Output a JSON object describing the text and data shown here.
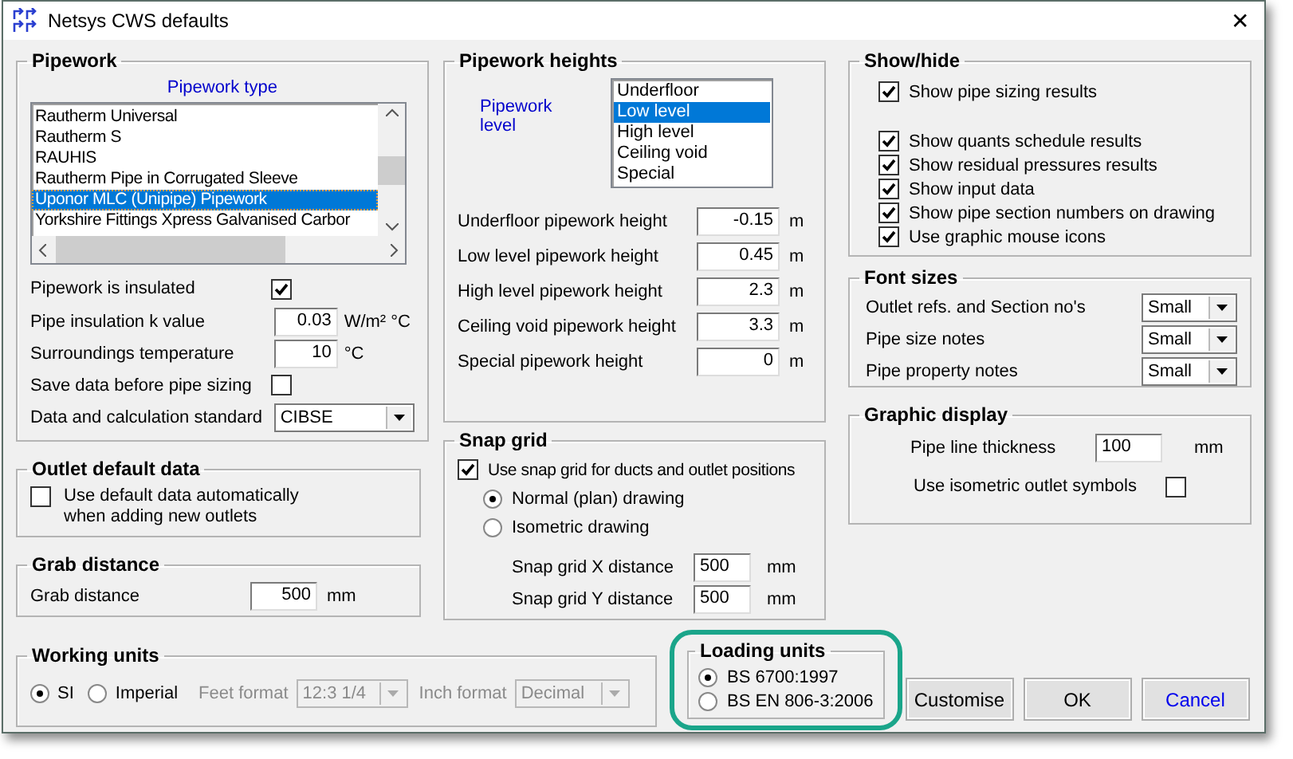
{
  "window": {
    "title": "Netsys CWS defaults",
    "close": "✕"
  },
  "pipework": {
    "title": "Pipework",
    "type_label": "Pipework type",
    "types": [
      {
        "label": "Rautherm Universal",
        "selected": false
      },
      {
        "label": "Rautherm S",
        "selected": false
      },
      {
        "label": "RAUHIS",
        "selected": false
      },
      {
        "label": "Rautherm Pipe in Corrugated Sleeve",
        "selected": false
      },
      {
        "label": "Uponor MLC (Unipipe) Pipework",
        "selected": true
      },
      {
        "label": "Yorkshire Fittings Xpress Galvanised Carbor",
        "selected": false
      }
    ],
    "fields": [
      {
        "kind": "checkbox",
        "label": "Pipework is insulated",
        "checked": true
      },
      {
        "kind": "number",
        "label": "Pipe insulation k value",
        "value": "0.03",
        "unit": "W/m² °C"
      },
      {
        "kind": "number",
        "label": "Surroundings temperature",
        "value": "10",
        "unit": "°C"
      },
      {
        "kind": "checkbox",
        "label": "Save data before pipe sizing",
        "checked": false
      },
      {
        "kind": "select",
        "label": "Data and calculation standard",
        "value": "CIBSE"
      }
    ]
  },
  "outlet_default_data": {
    "title": "Outlet default data",
    "option": {
      "label": "Use default data automatically when adding new outlets",
      "checked": false
    }
  },
  "grab_distance": {
    "title": "Grab distance",
    "label": "Grab distance",
    "value": "500",
    "unit": "mm"
  },
  "working_units": {
    "title": "Working units",
    "options": [
      {
        "label": "SI",
        "selected": true
      },
      {
        "label": "Imperial",
        "selected": false
      }
    ],
    "formats": [
      {
        "label": "Feet format",
        "value": "12:3 1/4",
        "disabled": true
      },
      {
        "label": "Inch format",
        "value": "Decimal",
        "disabled": true
      }
    ]
  },
  "pipework_heights": {
    "title": "Pipework heights",
    "level_label": "Pipework level",
    "levels": [
      {
        "label": "Underfloor",
        "selected": false
      },
      {
        "label": "Low level",
        "selected": true
      },
      {
        "label": "High level",
        "selected": false
      },
      {
        "label": "Ceiling void",
        "selected": false
      },
      {
        "label": "Special",
        "selected": false
      }
    ],
    "heights": [
      {
        "label": "Underfloor pipework height",
        "value": "-0.15",
        "unit": "m"
      },
      {
        "label": "Low level pipework height",
        "value": "0.45",
        "unit": "m"
      },
      {
        "label": "High level pipework height",
        "value": "2.3",
        "unit": "m"
      },
      {
        "label": "Ceiling void pipework height",
        "value": "3.3",
        "unit": "m"
      },
      {
        "label": "Special pipework height",
        "value": "0",
        "unit": "m"
      }
    ]
  },
  "snap_grid": {
    "title": "Snap grid",
    "use_snap": {
      "label": "Use snap grid for ducts and outlet positions",
      "checked": true
    },
    "modes": [
      {
        "label": "Normal (plan) drawing",
        "selected": true
      },
      {
        "label": "Isometric drawing",
        "selected": false
      }
    ],
    "distances": [
      {
        "label": "Snap grid X distance",
        "value": "500",
        "unit": "mm"
      },
      {
        "label": "Snap grid Y distance",
        "value": "500",
        "unit": "mm"
      }
    ]
  },
  "show_hide": {
    "title": "Show/hide",
    "groups": [
      [
        {
          "label": "Show pipe sizing results",
          "checked": true
        }
      ],
      [
        {
          "label": "Show quants schedule results",
          "checked": true
        },
        {
          "label": "Show residual pressures results",
          "checked": true
        },
        {
          "label": "Show input data",
          "checked": true
        },
        {
          "label": "Show pipe section numbers on drawing",
          "checked": true
        },
        {
          "label": "Use graphic mouse icons",
          "checked": true
        }
      ]
    ]
  },
  "font_sizes": {
    "title": "Font sizes",
    "rows": [
      {
        "label": "Outlet refs. and Section no's",
        "value": "Small"
      },
      {
        "label": "Pipe size notes",
        "value": "Small"
      },
      {
        "label": "Pipe property notes",
        "value": "Small"
      }
    ]
  },
  "graphic_display": {
    "title": "Graphic display",
    "thickness": {
      "label": "Pipe line thickness",
      "value": "100",
      "unit": "mm"
    },
    "isometric": {
      "label": "Use isometric outlet symbols",
      "checked": false
    }
  },
  "loading_units": {
    "title": "Loading units",
    "options": [
      {
        "label": "BS 6700:1997",
        "selected": true
      },
      {
        "label": "BS EN 806-3:2006",
        "selected": false
      }
    ]
  },
  "buttons": [
    {
      "label": "Customise",
      "kind": "plain"
    },
    {
      "label": "OK",
      "kind": "plain"
    },
    {
      "label": "Cancel",
      "kind": "accent"
    }
  ]
}
